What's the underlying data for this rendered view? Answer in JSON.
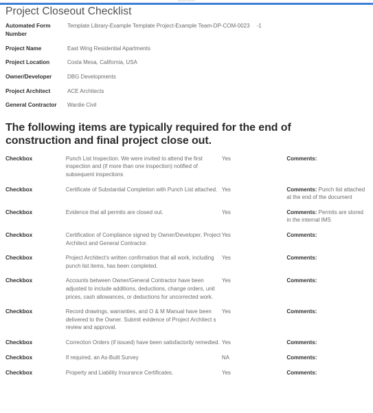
{
  "document": {
    "top_faint_text": "9182199m",
    "title": "Project Closeout Checklist",
    "accent_color": "#3d7fd6"
  },
  "metadata": {
    "fields": [
      {
        "label": "Automated Form Number",
        "value": "Template Library-Example Template Project-Example Team-DP-COM-0023",
        "value_suffix": "-1"
      },
      {
        "label": "Project Name",
        "value": "East Wing Residential Apartments",
        "value_suffix": ""
      },
      {
        "label": "Project Location",
        "value": "Costa Mesa, California, USA",
        "value_suffix": ""
      },
      {
        "label": "Owner/Developer",
        "value": "DBG Developments",
        "value_suffix": ""
      },
      {
        "label": "Project Architect",
        "value": "ACE Architects",
        "value_suffix": ""
      },
      {
        "label": "General Contractor",
        "value": "Wardie Civil",
        "value_suffix": ""
      }
    ]
  },
  "section": {
    "heading": "The following items are typically required for the end of construction and final project close out."
  },
  "checklist": {
    "rows": [
      {
        "checkbox_label": "Checkbox",
        "item": "Punch List Inspection. We were invited to attend the first inspection and (if more than one inspection) notified of subsequent inspections",
        "status": "Yes",
        "comments_label": "Comments:",
        "comments_text": ""
      },
      {
        "checkbox_label": "Checkbox",
        "item": "Certificate of Substantial Completion with Punch List attached.",
        "status": "Yes",
        "comments_label": "Comments:",
        "comments_text": " Punch list attached at the end of the document"
      },
      {
        "checkbox_label": "Checkbox",
        "item": "Evidence that all permits are closed out.",
        "status": "Yes",
        "comments_label": "Comments:",
        "comments_text": " Permits are stored in the internal IMS"
      },
      {
        "checkbox_label": "Checkbox",
        "item": "Certification of Compliance signed by Owner/Developer, Project Architect and General Contractor.",
        "status": "Yes",
        "comments_label": "Comments:",
        "comments_text": ""
      },
      {
        "checkbox_label": "Checkbox",
        "item": "Project Architect's written confirmation that all work, including punch list items, has been completed.",
        "status": "Yes",
        "comments_label": "Comments:",
        "comments_text": ""
      },
      {
        "checkbox_label": "Checkbox",
        "item": "Accounts between Owner/General Contractor have been adjusted to include additions, deductions, change orders, unit prices, cash allowances, or deductions for uncorrected work.",
        "status": "Yes",
        "comments_label": "Comments:",
        "comments_text": ""
      },
      {
        "checkbox_label": "Checkbox",
        "item": "Record drawings, warranties, and O & M Manual have been delivered to the Owner. Submit evidence of Project Architect s review and approval.",
        "status": "Yes",
        "comments_label": "Comments:",
        "comments_text": ""
      },
      {
        "checkbox_label": "Checkbox",
        "item": "Correction Orders (if issued) have been satisfactorily remedied.",
        "status": "Yes",
        "comments_label": "Comments:",
        "comments_text": ""
      },
      {
        "checkbox_label": "Checkbox",
        "item": "If required, an As-Built Survey",
        "status": "NA",
        "comments_label": "Comments:",
        "comments_text": ""
      },
      {
        "checkbox_label": "Checkbox",
        "item": "Property and Liability Insurance Certificates.",
        "status": "Yes",
        "comments_label": "Comments:",
        "comments_text": ""
      }
    ]
  }
}
